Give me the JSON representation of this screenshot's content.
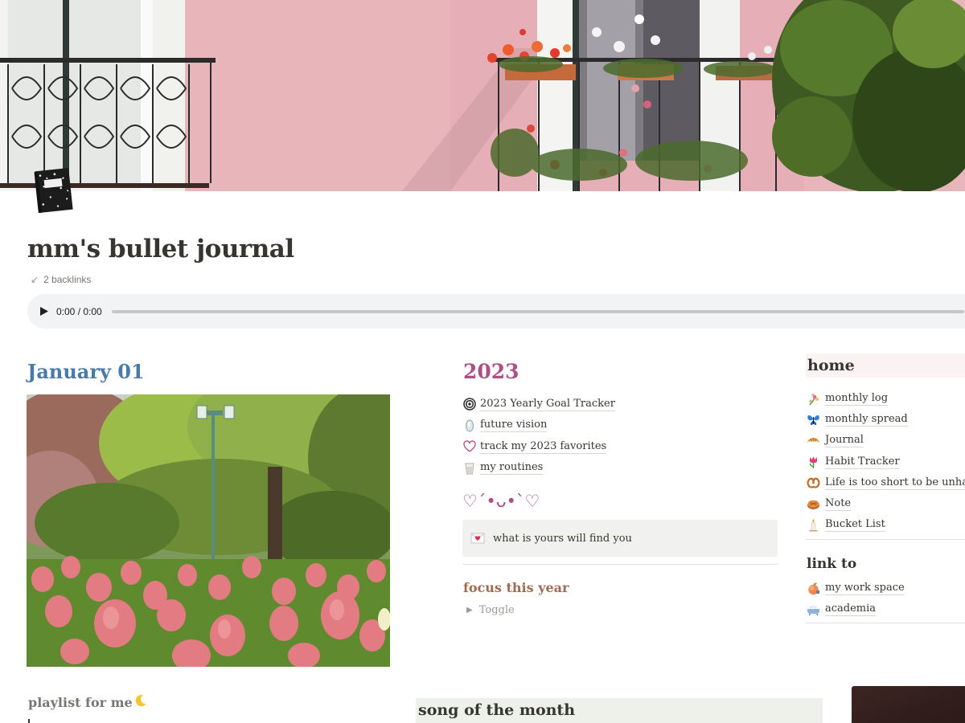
{
  "page": {
    "title": "mm's bullet journal",
    "backlinks": "2 backlinks"
  },
  "audio": {
    "time": "0:00 / 0:00",
    "progress_fraction": 0
  },
  "january": {
    "heading": "January 01"
  },
  "year_section": {
    "heading": "2023",
    "links": [
      {
        "label": "2023 Yearly Goal Tracker",
        "icon": "target-icon"
      },
      {
        "label": "future vision",
        "icon": "mirror-icon"
      },
      {
        "label": "track my 2023 favorites",
        "icon": "heart-outline-icon"
      },
      {
        "label": "my routines",
        "icon": "cup-icon"
      }
    ],
    "kaomoji": "♡´•ᴗ•`♡",
    "callout": "what is yours will find you",
    "focus_heading": "focus this year",
    "toggle_label": "Toggle"
  },
  "home": {
    "heading": "home",
    "items": [
      {
        "label": "monthly log",
        "icon": "bouquet-icon"
      },
      {
        "label": "monthly spread",
        "icon": "butterfly-icon"
      },
      {
        "label": "Journal",
        "icon": "croissant-icon"
      },
      {
        "label": "Habit Tracker",
        "icon": "tulip-icon"
      },
      {
        "label": "Life is too short to be unhappy",
        "icon": "pretzel-icon"
      },
      {
        "label": "Note",
        "icon": "pie-icon"
      },
      {
        "label": "Bucket List",
        "icon": "candle-icon"
      }
    ]
  },
  "link_to": {
    "heading": "link to",
    "items": [
      {
        "label": "my work space",
        "icon": "peach-icon"
      },
      {
        "label": "academia",
        "icon": "bathtub-icon"
      }
    ]
  },
  "playlist": {
    "heading": "playlist for me",
    "icon": "crescent-moon-icon"
  },
  "song": {
    "heading": "song of the month"
  },
  "colors": {
    "january": "#4a7aa8",
    "year": "#ad4e84",
    "focus": "#9f6b53",
    "callout_bg": "#f1f1ef",
    "home_bg": "#fbf3f3",
    "song_bg": "#eef0ea"
  }
}
